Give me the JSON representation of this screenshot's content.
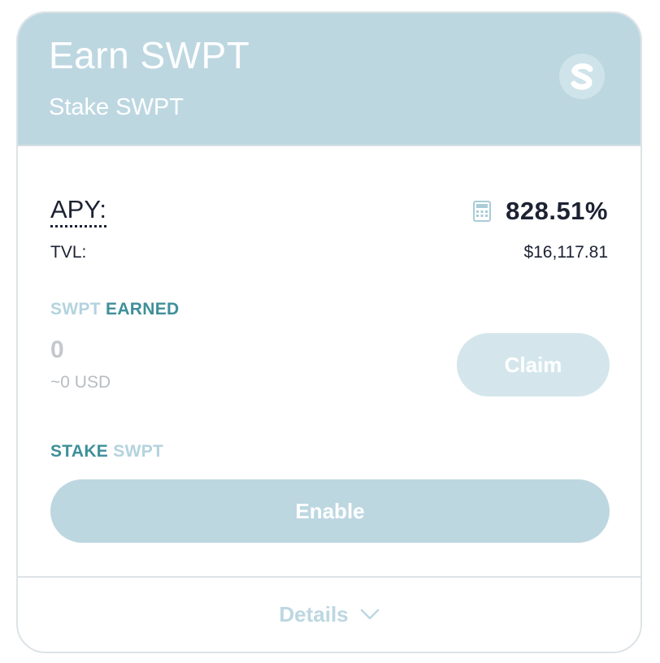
{
  "header": {
    "title": "Earn SWPT",
    "subtitle": "Stake SWPT",
    "logo_icon": "swpt-token-logo"
  },
  "stats": {
    "apy_label": "APY:",
    "apy_value": "828.51%",
    "calculator_icon": "calculator-icon",
    "tvl_label": "TVL:",
    "tvl_value": "$16,117.81"
  },
  "earned": {
    "token": "SWPT",
    "label": "EARNED",
    "amount": "0",
    "usd": "~0 USD",
    "claim_label": "Claim"
  },
  "stake": {
    "label": "STAKE",
    "token": "SWPT",
    "enable_label": "Enable"
  },
  "footer": {
    "details_label": "Details",
    "chevron_icon": "chevron-down-icon"
  },
  "colors": {
    "header_bg": "#bdd7e1",
    "accent_teal": "#3f8f9a",
    "accent_light": "#b3d3de",
    "text_dark": "#1d2233",
    "muted": "#c4c8cc"
  }
}
